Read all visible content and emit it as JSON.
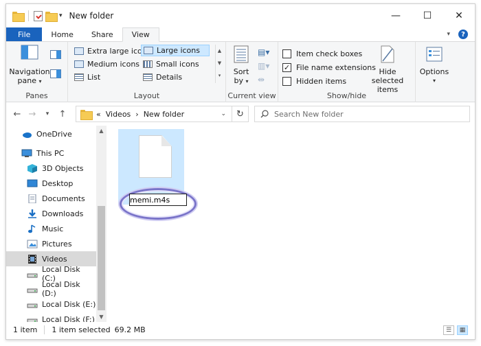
{
  "window": {
    "title": "New folder",
    "controls": {
      "minimize": "—",
      "maximize": "☐",
      "close": "✕"
    }
  },
  "ribbon_tabs": {
    "file": "File",
    "home": "Home",
    "share": "Share",
    "view": "View",
    "active": "View"
  },
  "ribbon": {
    "panes": {
      "navigation_pane_line1": "Navigation",
      "navigation_pane_line2": "pane",
      "label": "Panes"
    },
    "layout": {
      "items": [
        {
          "label": "Extra large icons"
        },
        {
          "label": "Large icons",
          "selected": true
        },
        {
          "label": "Medium icons"
        },
        {
          "label": "Small icons"
        },
        {
          "label": "List"
        },
        {
          "label": "Details"
        }
      ],
      "label": "Layout"
    },
    "current_view": {
      "sort_line1": "Sort",
      "sort_line2": "by",
      "label": "Current view"
    },
    "show_hide": {
      "item_check_boxes": {
        "label": "Item check boxes",
        "checked": false
      },
      "file_name_extensions": {
        "label": "File name extensions",
        "checked": true
      },
      "hidden_items": {
        "label": "Hidden items",
        "checked": false
      },
      "hide_selected_line1": "Hide selected",
      "hide_selected_line2": "items",
      "label": "Show/hide"
    },
    "options": {
      "label": "Options"
    }
  },
  "address_bar": {
    "prefix": "«",
    "crumbs": [
      "Videos",
      "New folder"
    ],
    "separator": "›"
  },
  "search": {
    "placeholder": "Search New folder"
  },
  "nav_pane": {
    "items": [
      {
        "label": "OneDrive",
        "icon": "cloud-icon"
      },
      {
        "label": "This PC",
        "icon": "computer-icon"
      },
      {
        "label": "3D Objects",
        "icon": "cube-icon"
      },
      {
        "label": "Desktop",
        "icon": "desktop-icon"
      },
      {
        "label": "Documents",
        "icon": "documents-icon"
      },
      {
        "label": "Downloads",
        "icon": "download-icon"
      },
      {
        "label": "Music",
        "icon": "music-icon"
      },
      {
        "label": "Pictures",
        "icon": "pictures-icon"
      },
      {
        "label": "Videos",
        "icon": "videos-icon",
        "selected": true
      },
      {
        "label": "Local Disk (C:)",
        "icon": "disk-icon"
      },
      {
        "label": "Local Disk (D:)",
        "icon": "disk-icon"
      },
      {
        "label": "Local Disk (E:)",
        "icon": "disk-icon"
      },
      {
        "label": "Local Disk (F:)",
        "icon": "disk-icon"
      }
    ]
  },
  "content": {
    "file": {
      "rename_value": "memi.m4s"
    }
  },
  "status_bar": {
    "count": "1 item",
    "selected": "1 item selected",
    "size": "69.2 MB"
  },
  "colors": {
    "file_tab": "#1a63bd",
    "selection": "#cce8ff",
    "highlight_ring": "#7a74c9"
  }
}
